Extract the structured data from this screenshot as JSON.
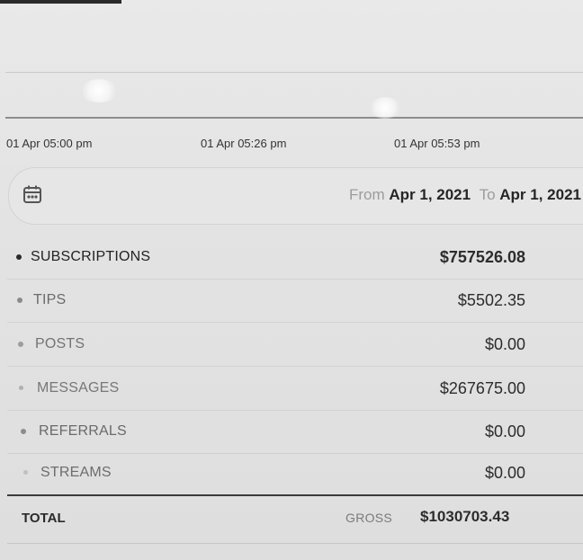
{
  "chart": {
    "x_ticks": [
      "01 Apr 05:00 pm",
      "01 Apr 05:26 pm",
      "01 Apr 05:53 pm"
    ]
  },
  "date_range": {
    "from_label": "From",
    "from_value": "Apr 1, 2021",
    "to_label": "To",
    "to_value": "Apr 1, 2021",
    "icon": "calendar-icon"
  },
  "earnings": {
    "rows": [
      {
        "label": "SUBSCRIPTIONS",
        "amount": "$757526.08"
      },
      {
        "label": "TIPS",
        "amount": "$5502.35"
      },
      {
        "label": "POSTS",
        "amount": "$0.00"
      },
      {
        "label": "MESSAGES",
        "amount": "$267675.00"
      },
      {
        "label": "REFERRALS",
        "amount": "$0.00"
      },
      {
        "label": "STREAMS",
        "amount": "$0.00"
      }
    ],
    "total_label": "TOTAL",
    "gross_label": "GROSS",
    "gross_amount": "$1030703.43"
  }
}
